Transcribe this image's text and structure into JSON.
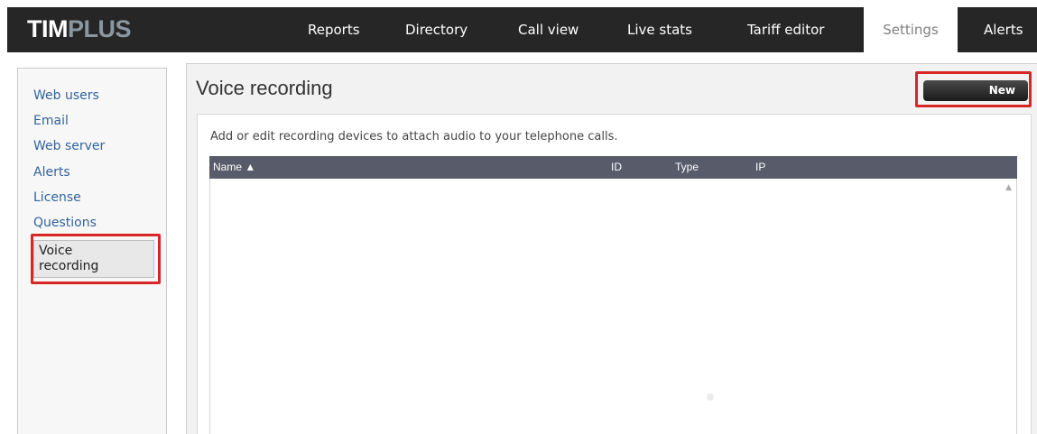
{
  "brand": {
    "logo_main": "TIM",
    "logo_plus": "PLUS"
  },
  "nav": {
    "items": [
      {
        "label": "Reports"
      },
      {
        "label": "Directory"
      },
      {
        "label": "Call view"
      },
      {
        "label": "Live stats"
      },
      {
        "label": "Tariff editor"
      },
      {
        "label": "Settings",
        "active": true
      },
      {
        "label": "Alerts"
      }
    ]
  },
  "sidebar": {
    "items": [
      {
        "label": "Web users"
      },
      {
        "label": "Email"
      },
      {
        "label": "Web server"
      },
      {
        "label": "Alerts"
      },
      {
        "label": "License"
      },
      {
        "label": "Questions"
      }
    ],
    "active_item": {
      "line1": "Voice",
      "line2": "recording"
    }
  },
  "main": {
    "title": "Voice recording",
    "new_button": "New",
    "description": "Add or edit recording devices to attach audio to your telephone calls.",
    "table": {
      "columns": [
        "Name ▲",
        "ID",
        "Type",
        "IP"
      ],
      "rows": []
    }
  },
  "colors": {
    "topbar": "#262626",
    "header_row": "#585b69",
    "link": "#33639c",
    "highlight": "#d82626"
  }
}
